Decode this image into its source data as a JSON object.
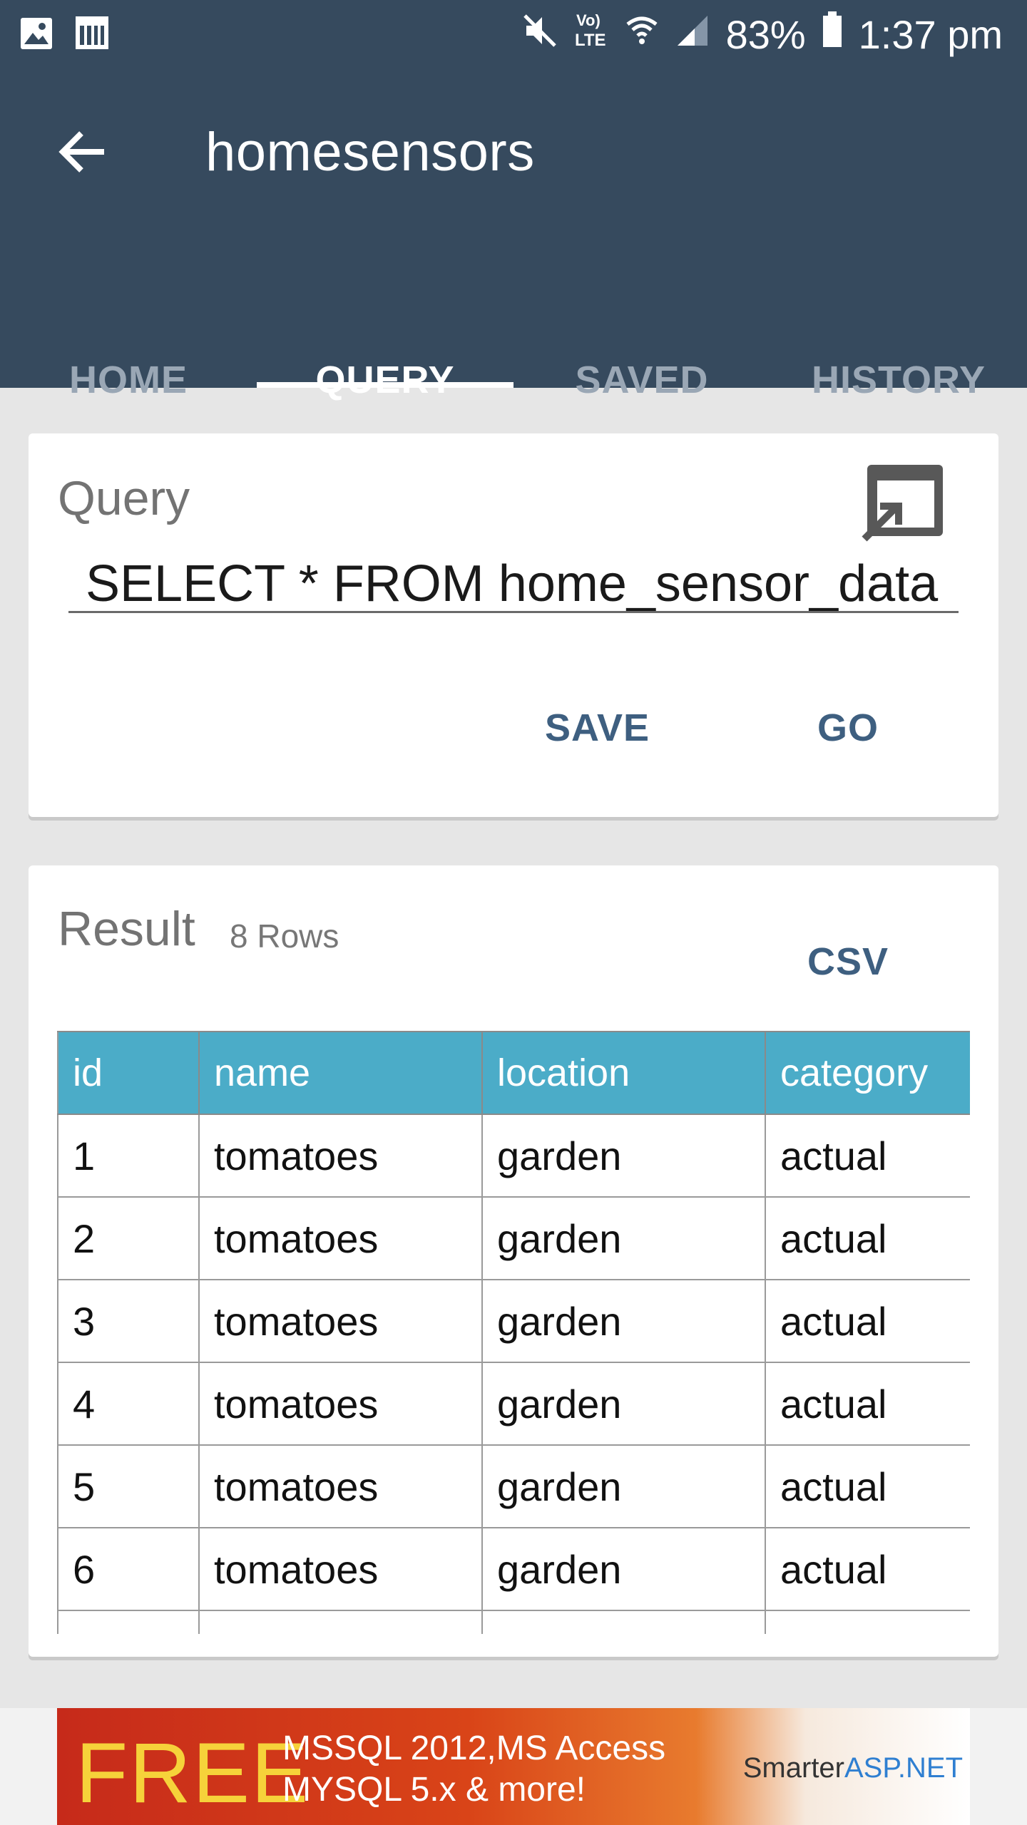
{
  "status_bar": {
    "battery": "83%",
    "time": "1:37 pm",
    "network": "LTE",
    "icons": [
      "image-icon",
      "calendar-icon",
      "mute-icon",
      "volte-icon",
      "wifi-icon",
      "signal-icon",
      "battery-icon"
    ]
  },
  "app_bar": {
    "title": "homesensors",
    "tabs": [
      {
        "label": "HOME",
        "active": false
      },
      {
        "label": "QUERY",
        "active": true
      },
      {
        "label": "SAVED",
        "active": false
      },
      {
        "label": "HISTORY",
        "active": false
      }
    ]
  },
  "query_card": {
    "title": "Query",
    "query_value": "SELECT * FROM home_sensor_data",
    "save_label": "SAVE",
    "go_label": "GO"
  },
  "result_card": {
    "title": "Result",
    "row_count": "8 Rows",
    "csv_label": "CSV",
    "columns": [
      "id",
      "name",
      "location",
      "category"
    ],
    "rows": [
      [
        "1",
        "tomatoes",
        "garden",
        "actual"
      ],
      [
        "2",
        "tomatoes",
        "garden",
        "actual"
      ],
      [
        "3",
        "tomatoes",
        "garden",
        "actual"
      ],
      [
        "4",
        "tomatoes",
        "garden",
        "actual"
      ],
      [
        "5",
        "tomatoes",
        "garden",
        "actual"
      ],
      [
        "6",
        "tomatoes",
        "garden",
        "actual"
      ],
      [
        "",
        "",
        "",
        ""
      ]
    ]
  },
  "ad": {
    "free": "FREE",
    "line1": "MSSQL 2012,MS Access",
    "line2": "MYSQL 5.x & more!",
    "brand_main": "Smarter",
    "brand_accent": "ASP.NET"
  },
  "colors": {
    "app_bar": "#364a5e",
    "table_header": "#4bacc8",
    "button_text": "#3e5f80"
  }
}
